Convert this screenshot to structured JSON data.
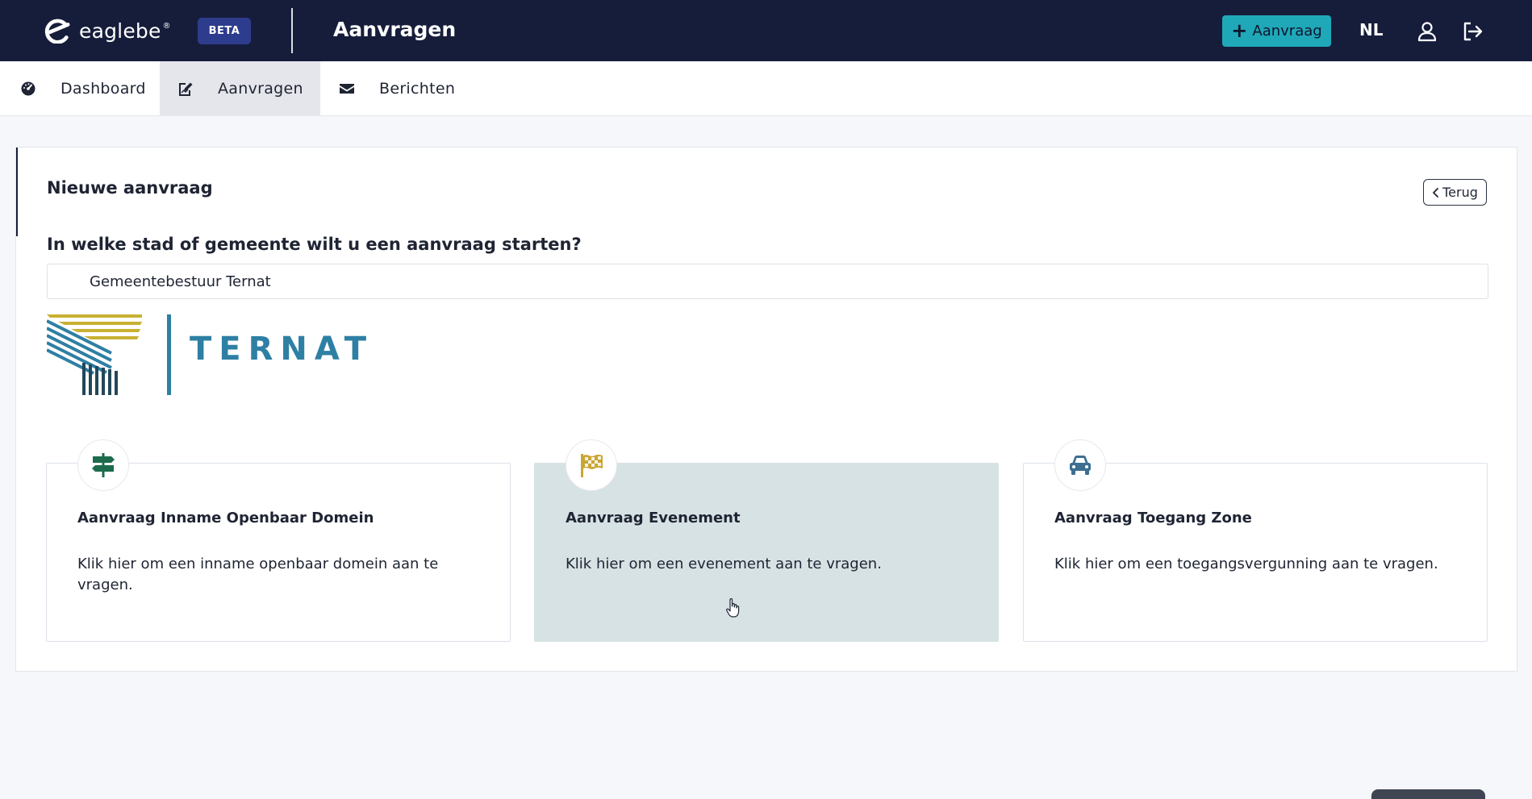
{
  "header": {
    "brand": "eaglebe",
    "brand_mark": "®",
    "beta_label": "BETA",
    "title": "Aanvragen",
    "new_request_label": "Aanvraag",
    "language": "NL",
    "icons": [
      "user-icon",
      "logout-icon",
      "plus-icon"
    ]
  },
  "nav": {
    "tabs": [
      {
        "label": "Dashboard",
        "icon": "gauge-icon",
        "active": false
      },
      {
        "label": "Aanvragen",
        "icon": "edit-icon",
        "active": true
      },
      {
        "label": "Berichten",
        "icon": "envelope-icon",
        "active": false
      }
    ]
  },
  "main": {
    "card_title": "Nieuwe aanvraag",
    "back_label": "Terug",
    "question": "In welke stad of gemeente wilt u een aanvraag starten?",
    "city_value": "Gemeentebestuur Ternat",
    "city_logo_text": "TERNAT",
    "options": [
      {
        "title": "Aanvraag Inname Openbaar Domein",
        "description": "Klik hier om een inname openbaar domein aan te vragen.",
        "icon": "signpost-icon",
        "icon_color": "#1d6b4d"
      },
      {
        "title": "Aanvraag Evenement",
        "description": "Klik hier om een evenement aan te vragen.",
        "icon": "checkered-flag-icon",
        "icon_color": "#c9a634"
      },
      {
        "title": "Aanvraag Toegang Zone",
        "description": "Klik hier om een toegangsvergunning aan te vragen.",
        "icon": "car-icon",
        "icon_color": "#3d6f91"
      }
    ]
  },
  "colors": {
    "topbar": "#161d3b",
    "beta_badge": "#2e3c8e",
    "accent_button": "#1fa8b8",
    "active_tile": "#d7e2e4",
    "brand_blue": "#2e7fa4",
    "brand_gold": "#c9b132"
  }
}
